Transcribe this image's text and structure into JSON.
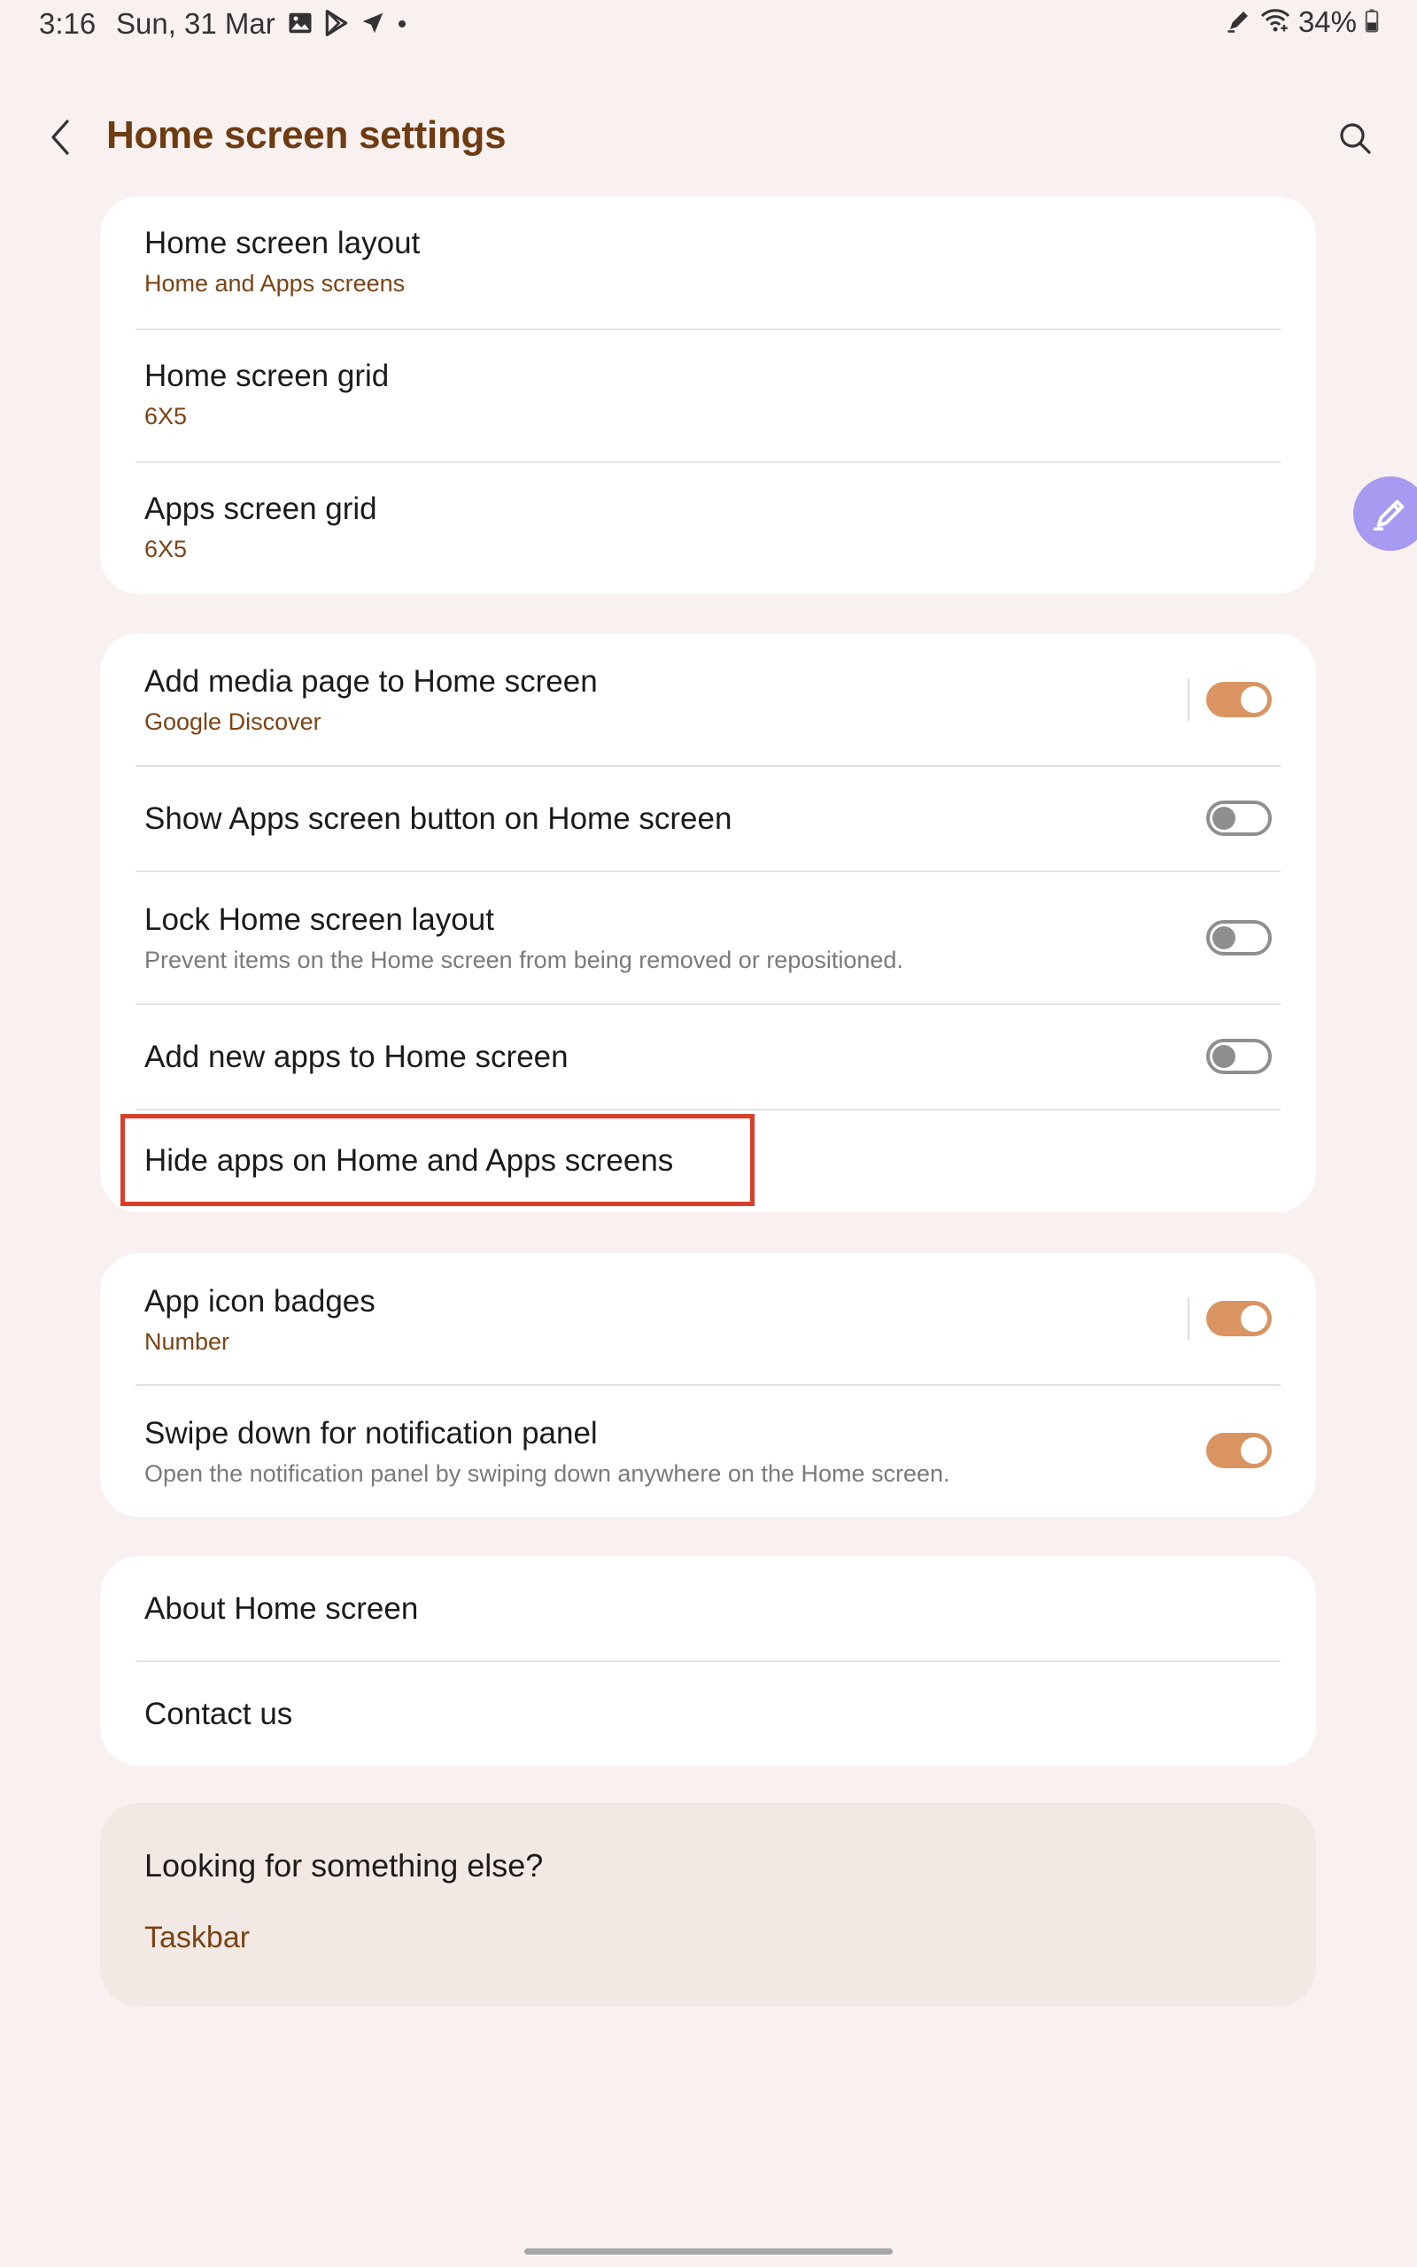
{
  "status_bar": {
    "time": "3:16",
    "date": "Sun, 31 Mar",
    "battery": "34%",
    "left_icons": [
      "gallery-icon",
      "play-store-icon",
      "navigation-icon",
      "dot-icon"
    ],
    "right_icons": [
      "pen-icon",
      "wifi-icon",
      "battery-icon"
    ]
  },
  "header": {
    "title": "Home screen settings",
    "back_icon": "chevron-left-icon",
    "search_icon": "search-icon"
  },
  "sections": {
    "layout": {
      "home_layout": {
        "title": "Home screen layout",
        "subtitle": "Home and Apps screens"
      },
      "home_grid": {
        "title": "Home screen grid",
        "subtitle": "6X5"
      },
      "apps_grid": {
        "title": "Apps screen grid",
        "subtitle": "6X5"
      }
    },
    "options": {
      "media_page": {
        "title": "Add media page to Home screen",
        "subtitle": "Google Discover",
        "toggle": "on"
      },
      "apps_button": {
        "title": "Show Apps screen button on Home screen",
        "toggle": "off"
      },
      "lock_layout": {
        "title": "Lock Home screen layout",
        "subtitle": "Prevent items on the Home screen from being removed or repositioned.",
        "toggle": "off"
      },
      "add_new_apps": {
        "title": "Add new apps to Home screen",
        "toggle": "off"
      },
      "hide_apps": {
        "title": "Hide apps on Home and Apps screens"
      }
    },
    "notifications": {
      "badges": {
        "title": "App icon badges",
        "subtitle": "Number",
        "toggle": "on"
      },
      "swipe_down": {
        "title": "Swipe down for notification panel",
        "subtitle": "Open the notification panel by swiping down anywhere on the Home screen.",
        "toggle": "on"
      }
    },
    "about": {
      "about_home": {
        "title": "About Home screen"
      },
      "contact": {
        "title": "Contact us"
      }
    },
    "suggestions": {
      "title": "Looking for something else?",
      "link": "Taskbar"
    }
  },
  "colors": {
    "accent": "#d99462",
    "title_brown": "#6e3b12",
    "subtitle_brown": "#7a4416",
    "highlight_red": "#d8402b",
    "background": "#f8f1ef"
  }
}
